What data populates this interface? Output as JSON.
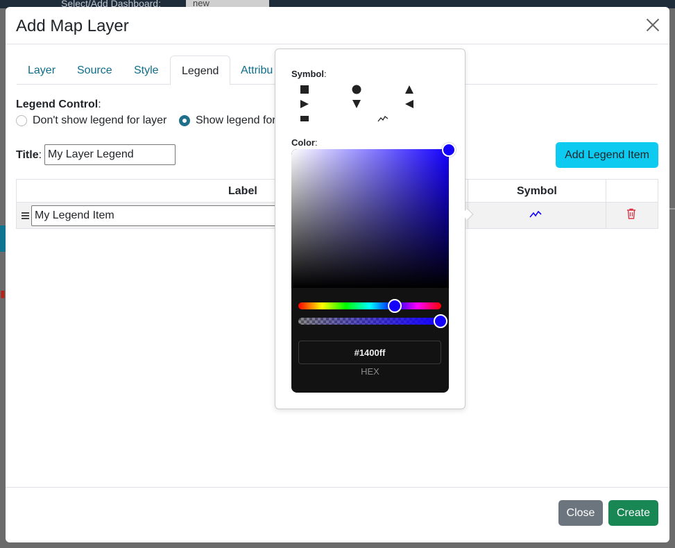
{
  "backdrop": {
    "topbar_text": "Select/Add Dashboard:",
    "topbar_input": "new"
  },
  "modal": {
    "title": "Add Map Layer",
    "tabs": [
      {
        "label": "Layer",
        "active": false
      },
      {
        "label": "Source",
        "active": false
      },
      {
        "label": "Style",
        "active": false
      },
      {
        "label": "Legend",
        "active": true
      },
      {
        "label": "Attribu",
        "active": false
      }
    ],
    "legend_control": {
      "label": "Legend Control",
      "options": [
        {
          "label": "Don't show legend for layer",
          "checked": false
        },
        {
          "label": "Show legend for",
          "checked": true
        }
      ]
    },
    "title_field": {
      "label": "Title",
      "value": "My Layer Legend"
    },
    "add_legend_item_label": "Add Legend Item",
    "table": {
      "headers": {
        "label": "Label",
        "symbol": "Symbol"
      },
      "rows": [
        {
          "label": "My Legend Item",
          "symbol": "line-symbol-icon",
          "symbol_color": "#1400ff"
        }
      ]
    },
    "footer": {
      "close_label": "Close",
      "create_label": "Create"
    }
  },
  "popover": {
    "symbol_label": "Symbol",
    "symbols": [
      "square",
      "circle",
      "triangle-up",
      "triangle-right",
      "triangle-down",
      "triangle-left",
      "rectangle",
      "line"
    ],
    "color_label": "Color",
    "color_picker": {
      "hex_value": "#1400ff",
      "format_label": "HEX",
      "alpha": 1
    }
  }
}
